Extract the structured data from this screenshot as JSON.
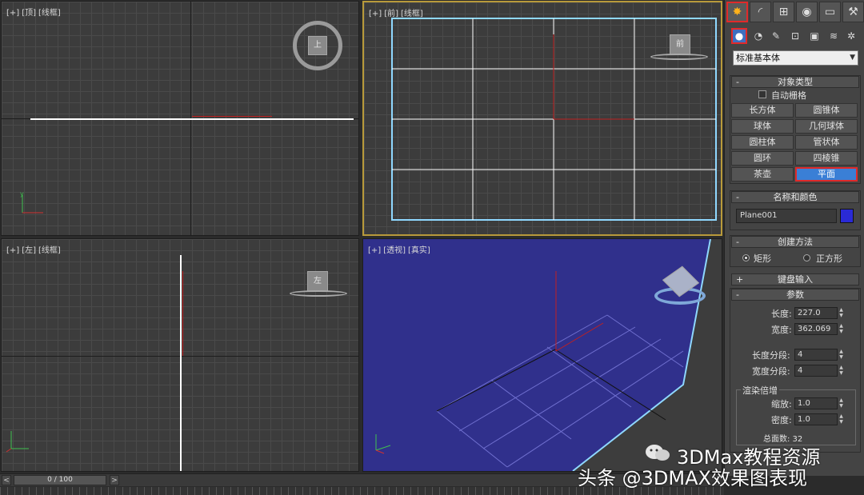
{
  "viewports": {
    "top": {
      "plus": "[+]",
      "view": "[顶]",
      "mode": "[线框]",
      "cube_label": "上"
    },
    "front": {
      "plus": "[+]",
      "view": "[前]",
      "mode": "[线框]",
      "cube_label": "前"
    },
    "left": {
      "plus": "[+]",
      "view": "[左]",
      "mode": "[线框]",
      "cube_label": "左"
    },
    "persp": {
      "plus": "[+]",
      "view": "[透视]",
      "mode": "[真实]"
    }
  },
  "command_panel": {
    "tabs": [
      "create-icon",
      "modify-icon",
      "hierarchy-icon",
      "motion-icon",
      "display-icon",
      "utilities-icon"
    ],
    "active_tab": "create",
    "geometry_dropdown": "标准基本体",
    "object_type": {
      "title": "对象类型",
      "autogrid": "自动栅格",
      "buttons": [
        "长方体",
        "圆锥体",
        "球体",
        "几何球体",
        "圆柱体",
        "管状体",
        "圆环",
        "四棱锥",
        "茶壶",
        "平面"
      ],
      "selected": "平面"
    },
    "name_color": {
      "title": "名称和颜色",
      "name": "Plane001",
      "color": "#2a2ad6"
    },
    "creation_method": {
      "title": "创建方法",
      "options": [
        "矩形",
        "正方形"
      ],
      "selected": "矩形"
    },
    "keyboard_entry": {
      "title": "键盘输入"
    },
    "parameters": {
      "title": "参数",
      "length_label": "长度:",
      "length": "227.0",
      "width_label": "宽度:",
      "width": "362.069",
      "length_segs_label": "长度分段:",
      "length_segs": "4",
      "width_segs_label": "宽度分段:",
      "width_segs": "4",
      "render_group": "渲染倍增",
      "scale_label": "缩放:",
      "scale": "1.0",
      "density_label": "密度:",
      "density": "1.0",
      "total_faces": "总面数: 32"
    }
  },
  "timebar": {
    "frame": "0 / 100",
    "prev": "<",
    "next": ">"
  },
  "watermark": {
    "line1": "3DMax教程资源",
    "line2": "头条 @3DMAX效果图表现"
  }
}
